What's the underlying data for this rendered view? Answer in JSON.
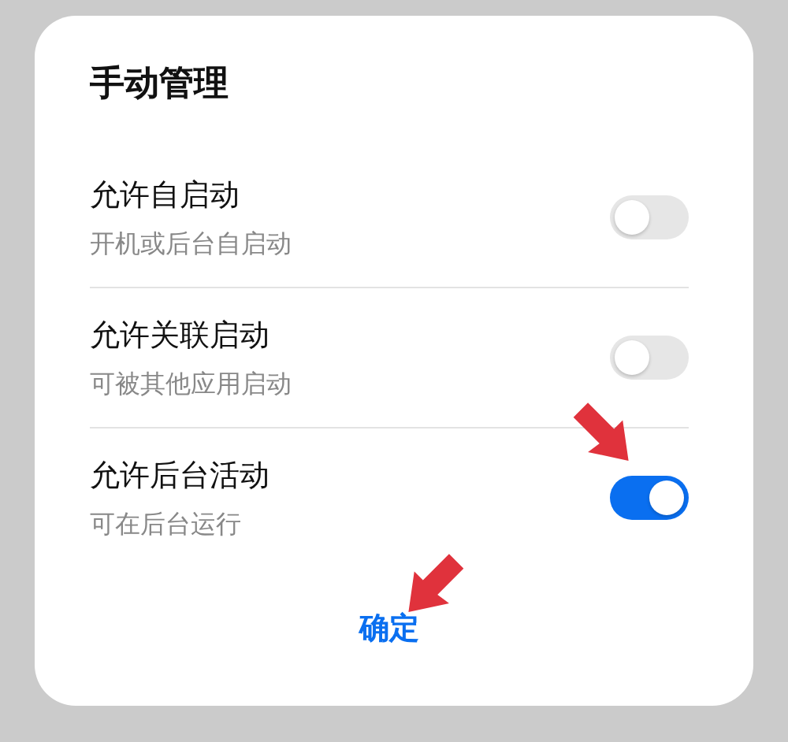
{
  "dialog": {
    "title": "手动管理",
    "options": [
      {
        "label": "允许自启动",
        "description": "开机或后台自启动",
        "on": false
      },
      {
        "label": "允许关联启动",
        "description": "可被其他应用启动",
        "on": false
      },
      {
        "label": "允许后台活动",
        "description": "可在后台运行",
        "on": true
      }
    ],
    "confirm_button": "确定"
  }
}
